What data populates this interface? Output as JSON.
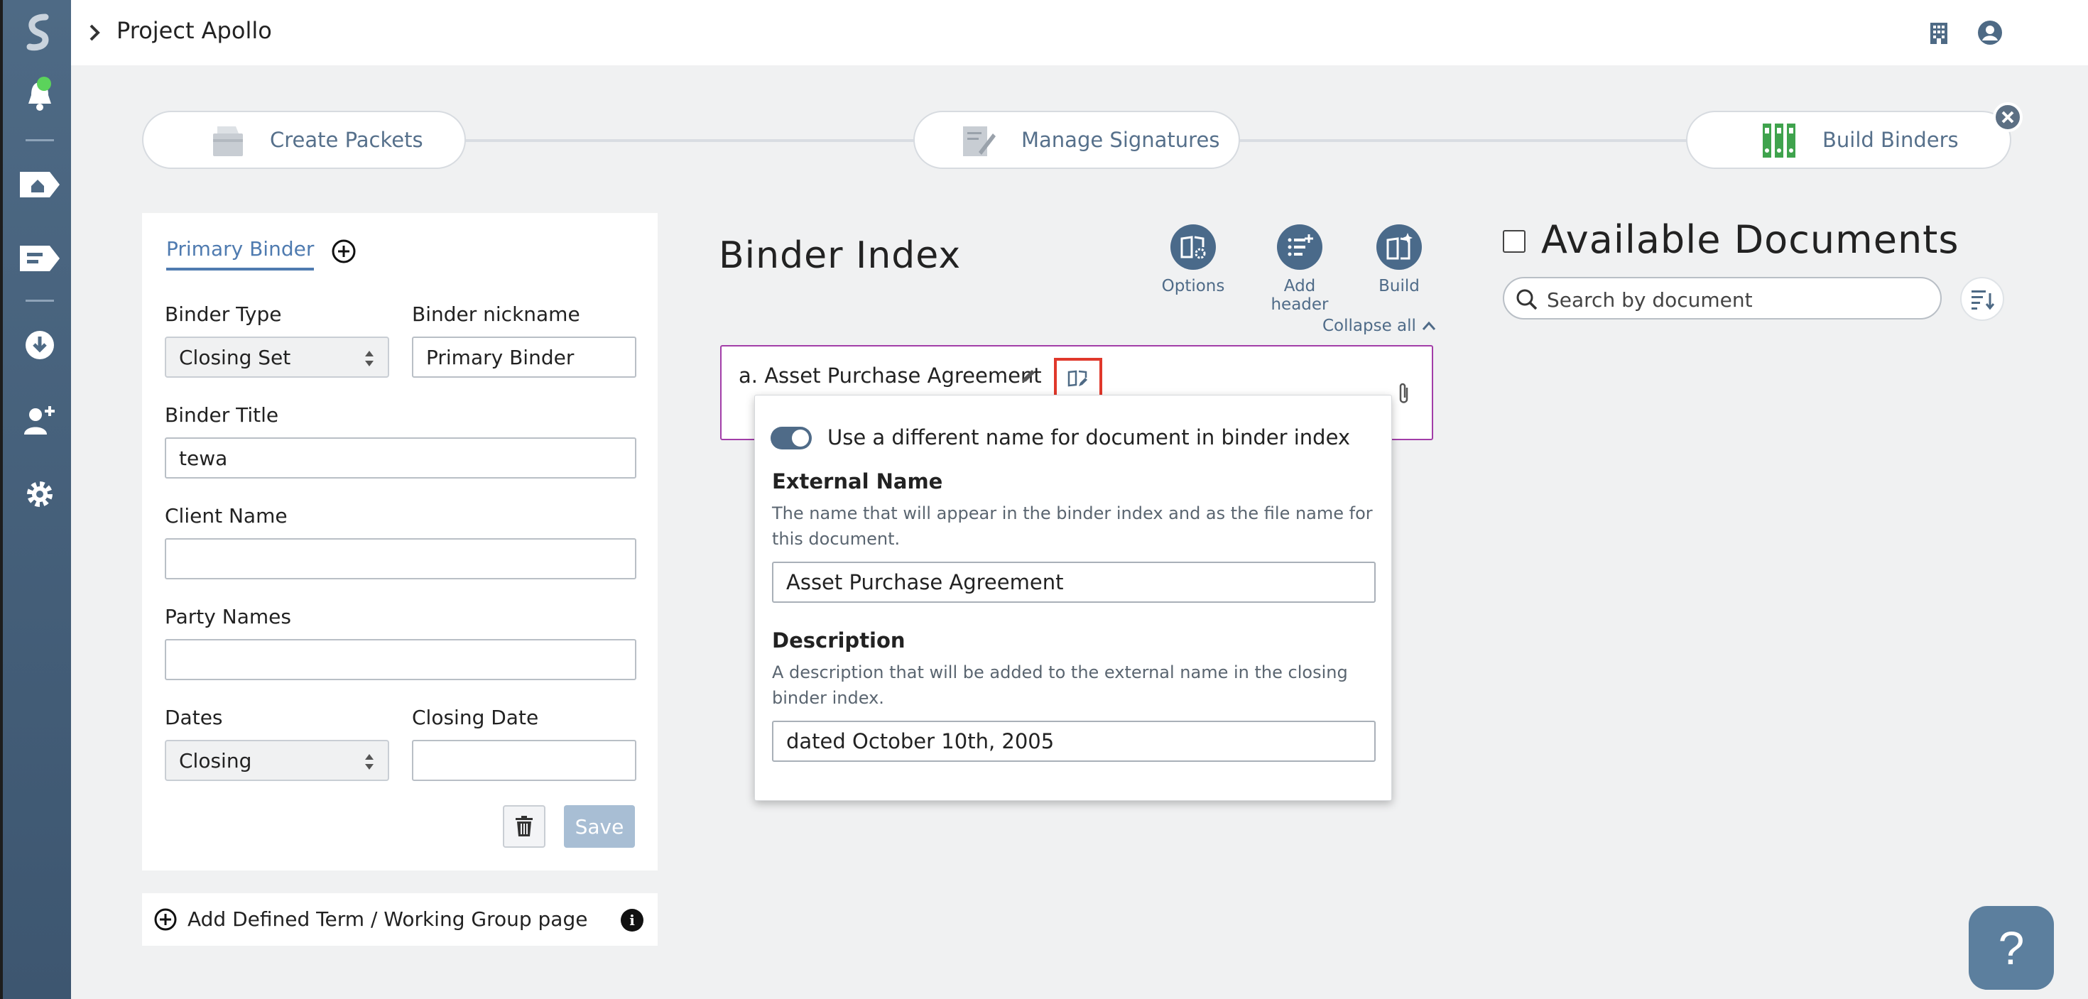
{
  "header": {
    "project_title": "Project Apollo",
    "icons": [
      "building-icon",
      "user-circle-icon"
    ]
  },
  "sidebar": {
    "items": [
      "bell-icon",
      "home-icon",
      "tag-icon",
      "download-icon",
      "add-user-icon",
      "gear-icon"
    ]
  },
  "steps": [
    {
      "label": "Create Packets",
      "icon": "packet-icon"
    },
    {
      "label": "Manage Signatures",
      "icon": "signature-icon"
    },
    {
      "label": "Build Binders",
      "icon": "binder-icon"
    }
  ],
  "binder_form": {
    "tab": "Primary Binder",
    "binder_type_label": "Binder Type",
    "binder_type_value": "Closing Set",
    "nickname_label": "Binder nickname",
    "nickname_value": "Primary Binder",
    "title_label": "Binder Title",
    "title_value": "tewa",
    "client_label": "Client Name",
    "client_value": "",
    "party_label": "Party Names",
    "party_value": "",
    "dates_label": "Dates",
    "dates_value": "Closing",
    "closing_date_label": "Closing Date",
    "closing_date_value": "",
    "save_label": "Save"
  },
  "defined_term": {
    "label": "Add Defined Term / Working Group page",
    "info": "i"
  },
  "binder_index": {
    "title": "Binder Index",
    "actions": [
      {
        "label": "Options",
        "icon": "book-gear-icon"
      },
      {
        "label": "Add header",
        "icon": "list-add-icon"
      },
      {
        "label": "Build",
        "icon": "book-sparkle-icon"
      }
    ],
    "collapse_all": "Collapse all",
    "doc_name": "a. Asset Purchase Agreement"
  },
  "popover": {
    "toggle_label": "Use a different name for document in binder index",
    "toggle_on": true,
    "external_name_heading": "External Name",
    "external_name_help": "The name that will appear in the binder index and as the file name for this document.",
    "external_name_value": "Asset Purchase Agreement",
    "description_heading": "Description",
    "description_help": "A description that will be added to the external name in the closing binder index.",
    "description_value": "dated October 10th, 2005"
  },
  "available_documents": {
    "title": "Available Documents",
    "search_placeholder": "Search by document"
  },
  "help": {
    "label": "?"
  }
}
